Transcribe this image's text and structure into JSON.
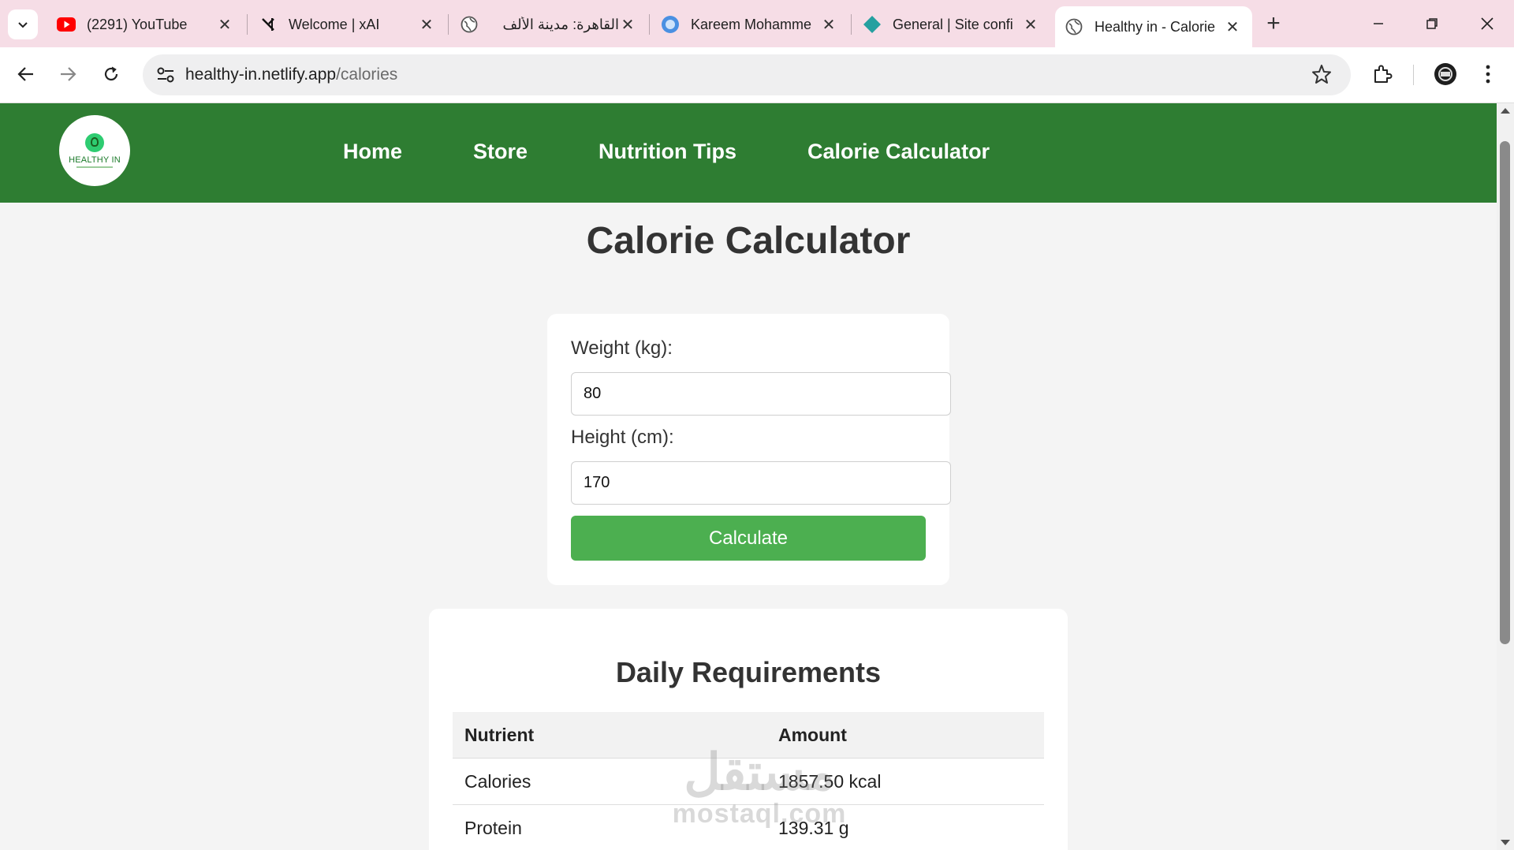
{
  "browser": {
    "tabs": [
      {
        "title": "(2291) YouTube",
        "icon": "youtube-icon"
      },
      {
        "title": "Welcome | xAI",
        "icon": "xai-icon"
      },
      {
        "title": "القاهرة: مدينة الألف",
        "icon": "globe-icon"
      },
      {
        "title": "Kareem Mohamme",
        "icon": "circle-icon"
      },
      {
        "title": "General | Site confi",
        "icon": "netlify-icon"
      },
      {
        "title": "Healthy in - Calorie",
        "icon": "globe-icon",
        "active": true
      }
    ],
    "url_host": "healthy-in.netlify.app",
    "url_path": "/calories"
  },
  "site": {
    "logo_text": "HEALTHY IN",
    "nav": [
      "Home",
      "Store",
      "Nutrition Tips",
      "Calorie Calculator"
    ]
  },
  "main": {
    "title": "Calorie Calculator",
    "form": {
      "weight_label": "Weight (kg):",
      "weight_value": "80",
      "height_label": "Height (cm):",
      "height_value": "170",
      "button_label": "Calculate"
    },
    "results": {
      "title": "Daily Requirements",
      "headers": [
        "Nutrient",
        "Amount"
      ],
      "rows": [
        {
          "nutrient": "Calories",
          "amount": "1857.50 kcal"
        },
        {
          "nutrient": "Protein",
          "amount": "139.31 g"
        }
      ]
    }
  },
  "watermark": {
    "arabic": "مستقل",
    "latin": "mostaql.com"
  },
  "colors": {
    "header_green": "#2e7d32",
    "button_green": "#4caf50",
    "tabbar_pink": "#f6dde6"
  }
}
